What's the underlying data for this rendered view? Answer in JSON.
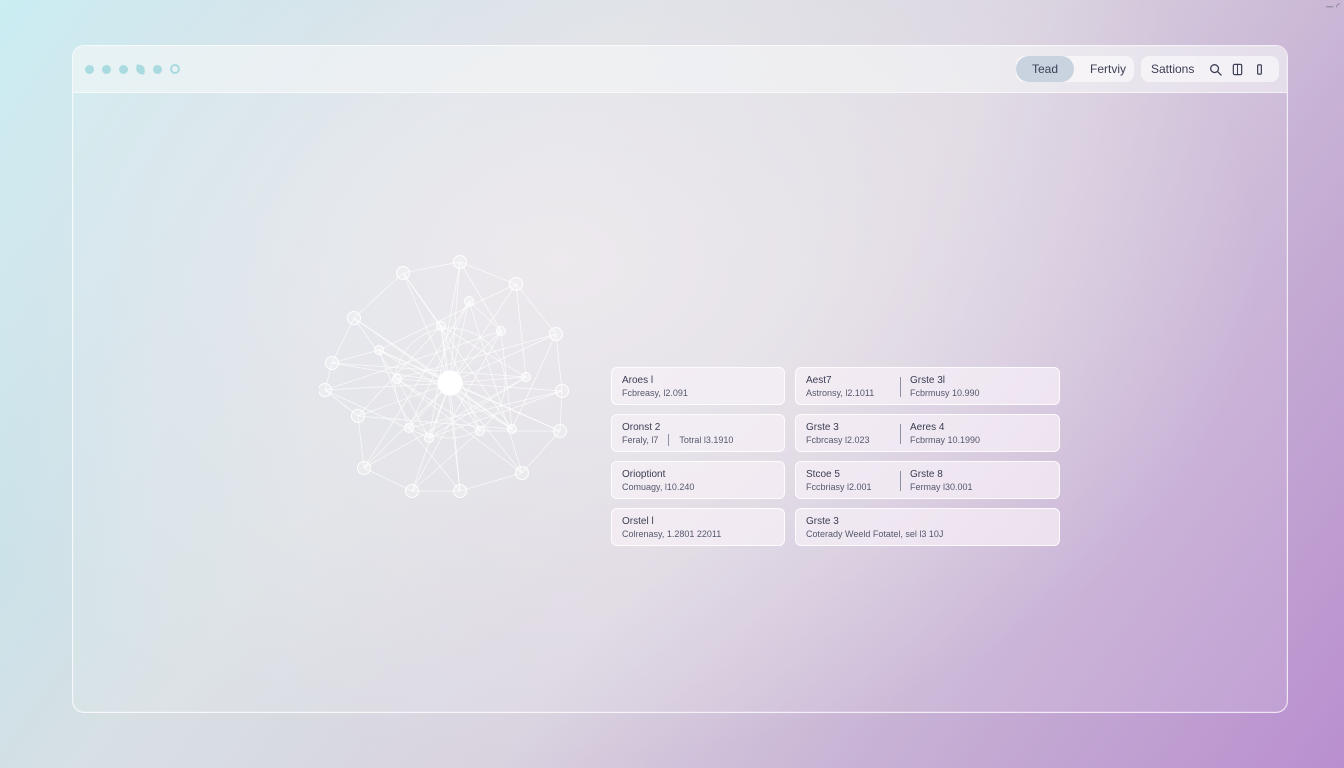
{
  "toolbar": {
    "tabs": [
      "Tead",
      "Fertviy"
    ],
    "settings_label": "Sattions"
  },
  "cards": [
    {
      "title": "Aroes l",
      "sub": "Fcbreasy, l2.091"
    },
    {
      "title": "Aest7",
      "sub": "Astronsy, l2.1011",
      "title2": "Grste 3l",
      "sub2": "Fcbrmusy 10.990"
    },
    {
      "title": "Oronst 2",
      "sub": "Feraly, l7",
      "sub_b": "Totral l3.1910"
    },
    {
      "title": "Grste 3",
      "sub": "Fcbrcasy l2.023",
      "title2": "Aeres 4",
      "sub2": "Fcbrmay 10.1990"
    },
    {
      "title": "Orioptiont",
      "sub": "Comuagy, l10.240"
    },
    {
      "title": "Stcoe 5",
      "sub": "Fccbriasy l2.001",
      "title2": "Grste 8",
      "sub2": "Fermay l30.001"
    },
    {
      "title": "Orstel l",
      "sub": "Colrenasy, 1.2801 22011"
    },
    {
      "title": "Grste 3",
      "sub": "Coterady Weeld Fotatel, sel l3 10J"
    }
  ],
  "colors": {
    "accent_dot": "#a9dbe0",
    "active_tab": "#c9d3e0",
    "card_bg": "#f6f0f6"
  },
  "icons": [
    "search-icon",
    "notebook-icon",
    "more-icon"
  ]
}
